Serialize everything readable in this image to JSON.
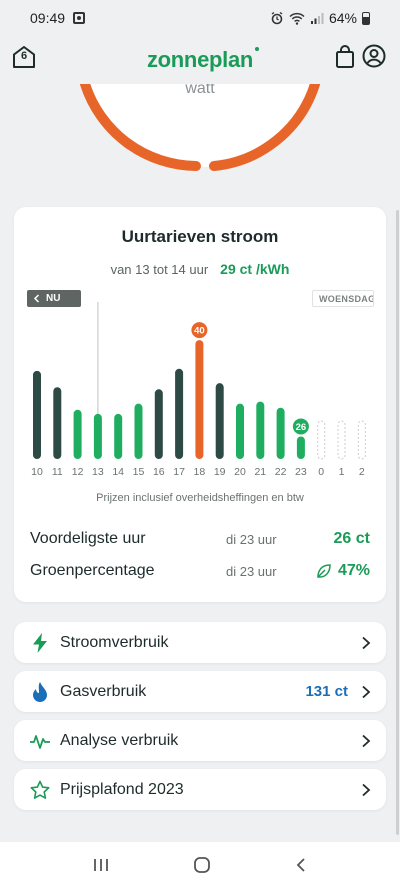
{
  "status_bar": {
    "time": "09:49",
    "battery": "64%"
  },
  "header": {
    "logo": "zonneplan",
    "home_badge": "6"
  },
  "gauge": {
    "unit": "watt"
  },
  "prices_card": {
    "title": "Uurtarieven stroom",
    "subtitle": "van 13 tot 14 uur",
    "current_price": "29 ct /kWh",
    "now_label": "NU",
    "next_day_label": "WOENSDAG",
    "footnote": "Prijzen inclusief overheidsheffingen en btw",
    "cheapest_label": "Voordeligste uur",
    "cheapest_when": "di 23 uur",
    "cheapest_value": "26 ct",
    "green_label": "Groenpercentage",
    "green_when": "di 23 uur",
    "green_value": "47%"
  },
  "chart_data": {
    "type": "bar",
    "categories": [
      "10",
      "11",
      "12",
      "13",
      "14",
      "15",
      "16",
      "17",
      "18",
      "19",
      "20",
      "21",
      "22",
      "23",
      "0",
      "1",
      "2"
    ],
    "values": [
      43,
      35,
      24,
      22,
      22,
      27,
      34,
      44,
      58,
      37,
      27,
      28,
      25,
      11,
      null,
      null,
      null
    ],
    "bar_status": [
      "past",
      "past",
      "green",
      "green",
      "green",
      "green",
      "past",
      "past",
      "peak",
      "past",
      "green",
      "green",
      "green",
      "green",
      "empty",
      "empty",
      "empty"
    ],
    "annotations": [
      {
        "category": "18",
        "label": "40"
      },
      {
        "category": "23",
        "label": "26"
      }
    ],
    "current_hour_marker": "13",
    "colors": {
      "past": "#2d4a44",
      "green": "#1fae60",
      "peak": "#e8652a",
      "empty": "#c8cdcb"
    }
  },
  "nav": [
    {
      "label": "Stroomverbruik",
      "value": "",
      "icon": "lightning-icon"
    },
    {
      "label": "Gasverbruik",
      "value": "131 ct",
      "icon": "flame-icon"
    },
    {
      "label": "Analyse verbruik",
      "value": "",
      "icon": "pulse-icon"
    },
    {
      "label": "Prijsplafond 2023",
      "value": "",
      "icon": "star-icon"
    }
  ],
  "colors": {
    "brand": "#1a9b58",
    "gauge": "#e8652a",
    "gas": "#1a6fb8"
  }
}
